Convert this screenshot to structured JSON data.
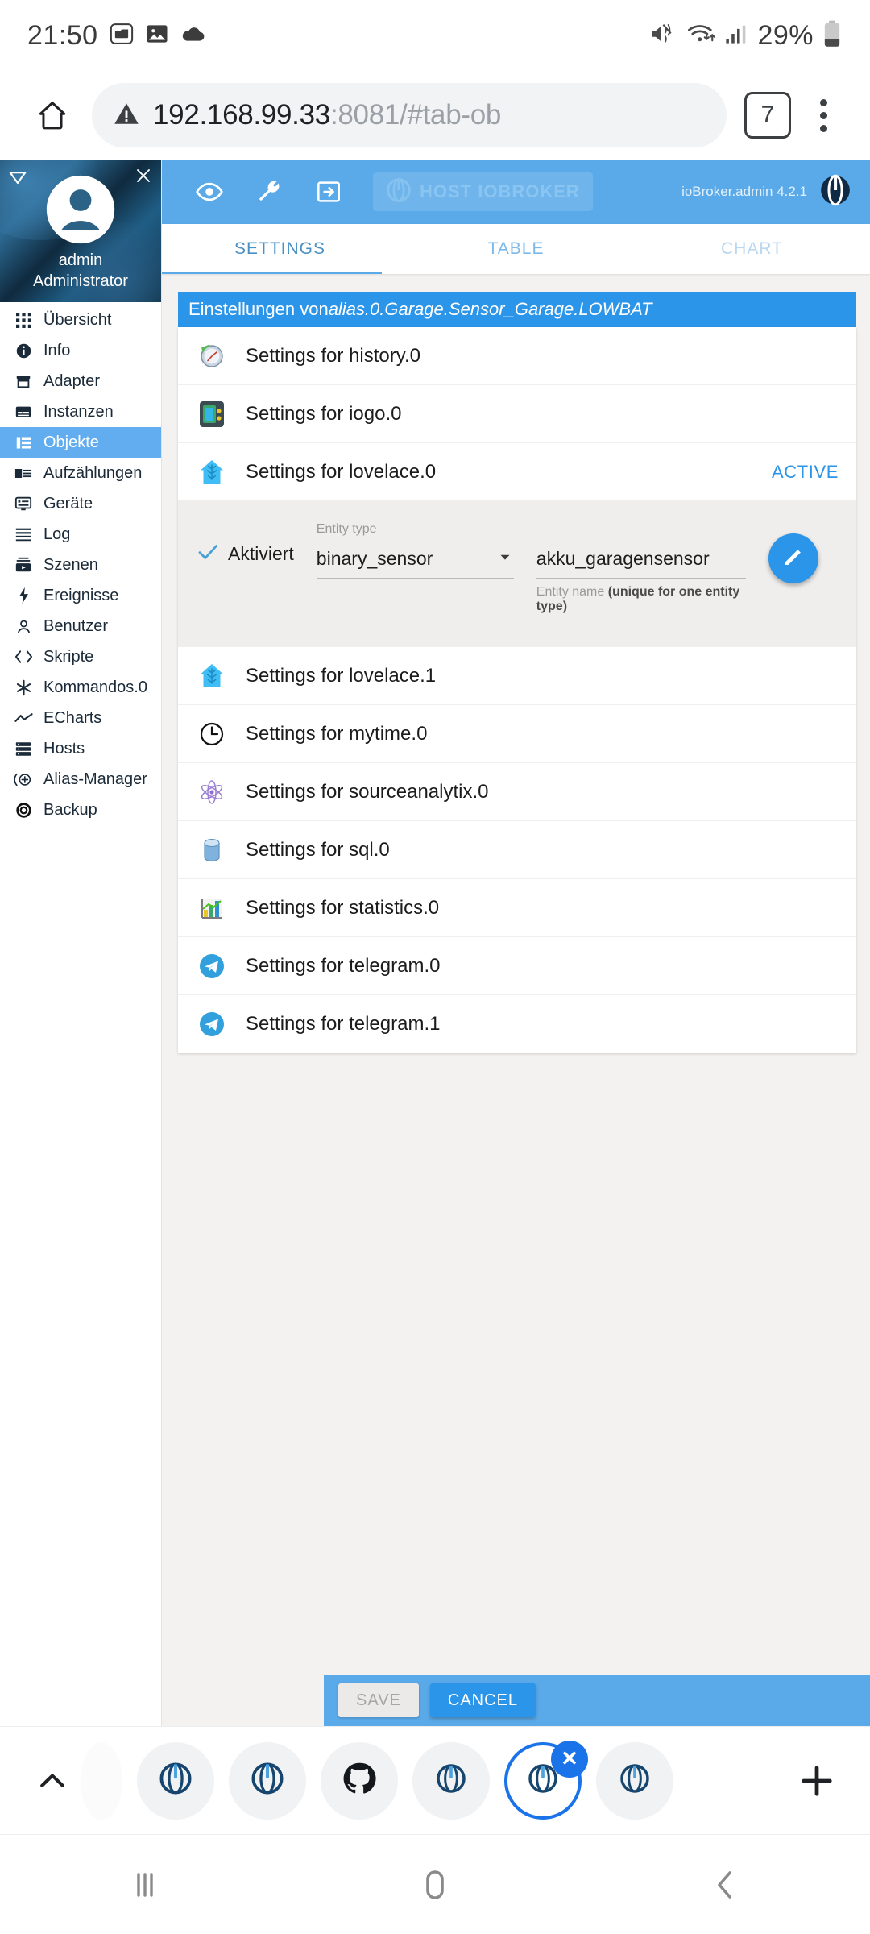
{
  "status_bar": {
    "clock": "21:50",
    "battery_percent": "29%",
    "icons": [
      "folder-icon",
      "image-icon",
      "cloud-icon",
      "mute-icon",
      "wifi-icon",
      "signal-icon",
      "battery-icon"
    ]
  },
  "browser": {
    "home_icon": "home-icon",
    "security_icon": "warning-triangle-icon",
    "url_host": "192.168.99.33",
    "url_rest": ":8081/#tab-ob",
    "tab_count": "7",
    "menu_icon": "kebab-menu-icon"
  },
  "sidebar": {
    "collapse_icon": "collapse-icon",
    "close_icon": "close-icon",
    "avatar_icon": "avatar-icon",
    "user_name": "admin",
    "user_role": "Administrator",
    "items": [
      {
        "label": "Übersicht",
        "icon": "grid-icon",
        "active": false
      },
      {
        "label": "Info",
        "icon": "info-icon",
        "active": false
      },
      {
        "label": "Adapter",
        "icon": "store-icon",
        "active": false
      },
      {
        "label": "Instanzen",
        "icon": "instances-icon",
        "active": false
      },
      {
        "label": "Objekte",
        "icon": "list-view-icon",
        "active": true
      },
      {
        "label": "Aufzählungen",
        "icon": "enum-icon",
        "active": false
      },
      {
        "label": "Geräte",
        "icon": "device-icon",
        "active": false
      },
      {
        "label": "Log",
        "icon": "log-lines-icon",
        "active": false
      },
      {
        "label": "Szenen",
        "icon": "scenes-icon",
        "active": false
      },
      {
        "label": "Ereignisse",
        "icon": "bolt-icon",
        "active": false
      },
      {
        "label": "Benutzer",
        "icon": "person-icon",
        "active": false
      },
      {
        "label": "Skripte",
        "icon": "code-brackets-icon",
        "active": false
      },
      {
        "label": "Kommandos.0",
        "icon": "asterisk-icon",
        "active": false
      },
      {
        "label": "ECharts",
        "icon": "line-chart-icon",
        "active": false
      },
      {
        "label": "Hosts",
        "icon": "server-icon",
        "active": false
      },
      {
        "label": "Alias-Manager",
        "icon": "alias-plus-icon",
        "active": false
      },
      {
        "label": "Backup",
        "icon": "backup-disc-icon",
        "active": false
      }
    ]
  },
  "appbar": {
    "eye_icon": "eye-icon",
    "wrench_icon": "wrench-icon",
    "export_icon": "export-icon",
    "host_chip_label": "HOST IOBROKER",
    "host_chip_icon": "iobroker-logo-icon",
    "version": "ioBroker.admin 4.2.1",
    "logo_icon": "iobroker-logo-icon",
    "bg_color": "#5aa9e8"
  },
  "tabs": [
    {
      "label": "SETTINGS",
      "state": "selected"
    },
    {
      "label": "TABLE",
      "state": "normal"
    },
    {
      "label": "CHART",
      "state": "dimmed"
    }
  ],
  "panel": {
    "title_prefix": "Einstellungen von ",
    "title_object": "alias.0.Garage.Sensor_Garage.LOWBAT",
    "title_bg": "#2b95e9"
  },
  "rows": [
    {
      "label": "Settings for history.0",
      "icon": "history-clock-icon",
      "badge": ""
    },
    {
      "label": "Settings for iogo.0",
      "icon": "iogo-app-icon",
      "badge": ""
    },
    {
      "label": "Settings for lovelace.0",
      "icon": "lovelace-house-icon",
      "badge": "ACTIVE"
    },
    {
      "label": "Settings for lovelace.1",
      "icon": "lovelace-house-icon",
      "badge": ""
    },
    {
      "label": "Settings for mytime.0",
      "icon": "clock-outline-icon",
      "badge": ""
    },
    {
      "label": "Settings for sourceanalytix.0",
      "icon": "atom-icon",
      "badge": ""
    },
    {
      "label": "Settings for sql.0",
      "icon": "database-icon",
      "badge": ""
    },
    {
      "label": "Settings for statistics.0",
      "icon": "bar-chart-icon",
      "badge": ""
    },
    {
      "label": "Settings for telegram.0",
      "icon": "telegram-icon",
      "badge": ""
    },
    {
      "label": "Settings for telegram.1",
      "icon": "telegram-icon",
      "badge": ""
    }
  ],
  "expanded_form": {
    "checkbox_icon": "check-icon",
    "checkbox_checked": true,
    "enabled_label": "Aktiviert",
    "entity_type_label": "Entity type",
    "entity_type_value": "binary_sensor",
    "entity_type_caret": "chevron-down-icon",
    "entity_name_value": "akku_garagensensor",
    "entity_name_helper_main": "Entity name ",
    "entity_name_helper_bold": "(unique for one entity type)",
    "edit_fab_icon": "pencil-icon"
  },
  "footer": {
    "save_label": "SAVE",
    "save_disabled": true,
    "cancel_label": "CANCEL",
    "bg_color": "#5aa9e8"
  },
  "tabstrip": {
    "chevron_icon": "chevron-up-icon",
    "plus_icon": "plus-icon",
    "close_icon": "close-icon",
    "accent_color": "#1a73e8",
    "items": [
      {
        "icon": "partial-tab",
        "state": "partial"
      },
      {
        "icon": "iobroker-logo-icon",
        "state": "normal"
      },
      {
        "icon": "iobroker-logo-icon",
        "state": "normal"
      },
      {
        "icon": "github-icon",
        "state": "normal"
      },
      {
        "icon": "iobroker-logo-icon",
        "state": "normal"
      },
      {
        "icon": "iobroker-logo-icon",
        "state": "current"
      },
      {
        "icon": "iobroker-logo-icon",
        "state": "normal"
      }
    ]
  },
  "navbar": {
    "recents_icon": "recents-icon",
    "home_icon": "home-circle-icon",
    "back_icon": "back-chevron-icon"
  }
}
